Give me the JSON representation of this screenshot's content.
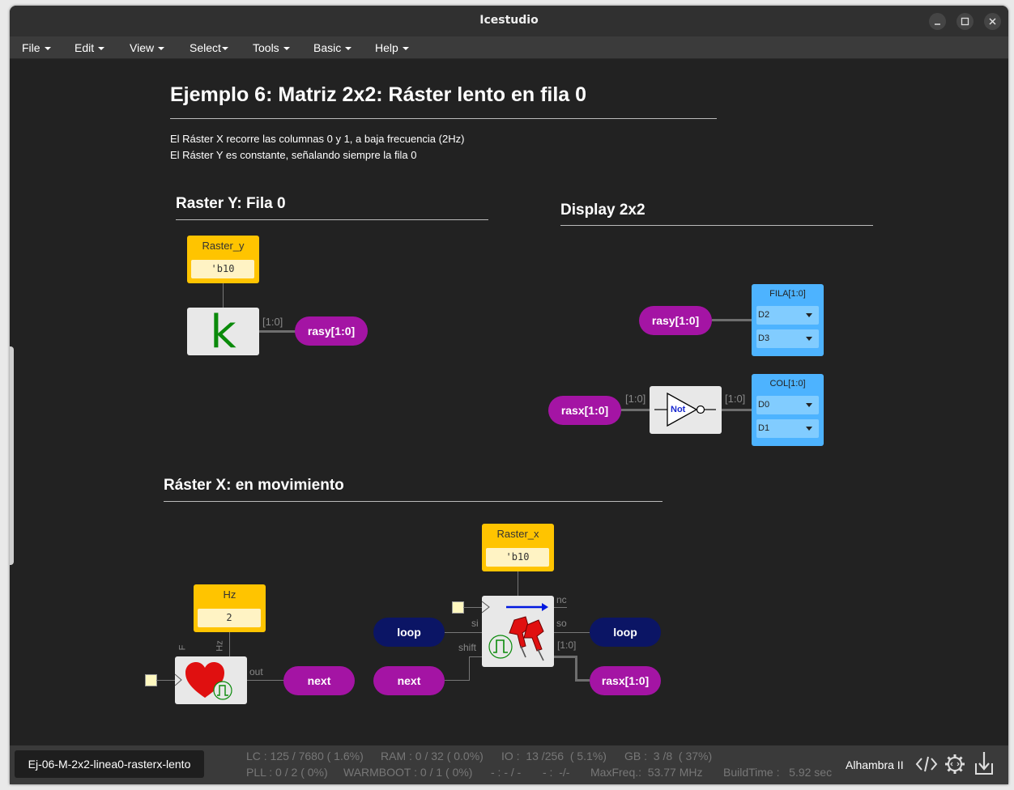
{
  "window": {
    "title": "Icestudio"
  },
  "menu": [
    {
      "label": "File",
      "caret": true
    },
    {
      "label": "Edit",
      "caret": true
    },
    {
      "label": "View",
      "caret": true
    },
    {
      "label": "Select",
      "caret": true
    },
    {
      "label": "Tools",
      "caret": true
    },
    {
      "label": "Basic",
      "caret": true
    },
    {
      "label": "Help",
      "caret": true
    }
  ],
  "doc": {
    "title": "Ejemplo 6: Matriz 2x2: Ráster lento en fila 0",
    "line1": "El Ráster X recorre las columnas 0 y 1, a baja frecuencia (2Hz)",
    "line2": "El Ráster Y es constante, señalando siempre la fila 0",
    "section_y": "Raster Y: Fila 0",
    "section_display": "Display 2x2",
    "section_x": "Ráster X: en movimiento"
  },
  "raster_y": {
    "const_name": "Raster_y",
    "const_value": "'b10",
    "glyph": "k",
    "bus_label": "[1:0]",
    "out_label": "rasy[1:0]"
  },
  "display": {
    "rasy_in": "rasy[1:0]",
    "rasx_in": "rasx[1:0]",
    "bus_in": "[1:0]",
    "bus_out": "[1:0]",
    "not_label": "Not",
    "fila": {
      "name": "FILA[1:0]",
      "pins": [
        "D2",
        "D3"
      ]
    },
    "col": {
      "name": "COL[1:0]",
      "pins": [
        "D0",
        "D1"
      ]
    }
  },
  "raster_x": {
    "hz_const_name": "Hz",
    "hz_const_value": "2",
    "pin_F": "F",
    "pin_Hz": "Hz",
    "pin_out": "out",
    "next_out": "next",
    "rx_const_name": "Raster_x",
    "rx_const_value": "'b10",
    "loop_in": "loop",
    "next_in": "next",
    "pin_si": "si",
    "pin_shift": "shift",
    "pin_nc": "nc",
    "pin_so": "so",
    "bus_label": "[1:0]",
    "loop_out": "loop",
    "rasx_out": "rasx[1:0]"
  },
  "status": {
    "filename": "Ej-06-M-2x2-linea0-rasterx-lento",
    "lc": "LC : 125 / 7680 ( 1.6%)",
    "ram": "RAM : 0 / 32 ( 0.0%)",
    "io": "IO :  13 /256  ( 5.1%)",
    "gb": "GB :  3 /8  ( 37%)",
    "pll": "PLL : 0 / 2 ( 0%)",
    "warmboot": "WARMBOOT : 0 / 1 ( 0%)",
    "dash1": "- : - / -",
    "dash2": "- :  -/-",
    "maxfreq": "MaxFreq.:  53.77 MHz",
    "buildtime": "BuildTime :   5.92 sec",
    "board": "Alhambra II"
  },
  "colors": {
    "constant": "#ffc400",
    "label_purple": "#a414a4",
    "label_navy": "#0b1565",
    "output_blue": "#4db3ff",
    "canvas": "#222222"
  }
}
